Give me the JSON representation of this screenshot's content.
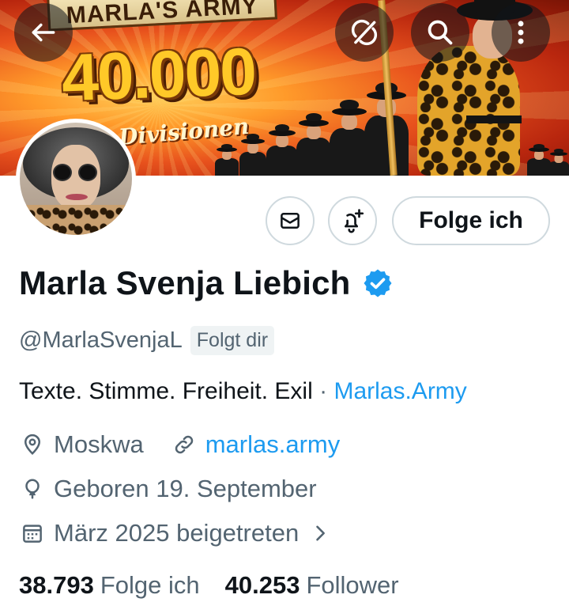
{
  "banner": {
    "ribbon_text": "MARLA'S ARMY",
    "headline": "40.000",
    "subline": "Divisionen"
  },
  "profile": {
    "display_name": "Marla Svenja Liebich",
    "verified": true,
    "handle": "@MarlaSvenjaL",
    "follows_you_badge": "Folgt dir",
    "bio_text": "Texte. Stimme. Freiheit. Exil",
    "bio_separator": "·",
    "bio_link": "Marlas.Army",
    "location": "Moskwa",
    "website": "marlas.army",
    "birthday": "Geboren 19. September",
    "joined": "März 2025 beigetreten"
  },
  "actions": {
    "follow_label": "Folge ich",
    "message_icon": "mail-icon",
    "notify_icon": "bell-plus-icon"
  },
  "toolbar": {
    "back_icon": "arrow-left-icon",
    "boost_icon": "repost-off-icon",
    "search_icon": "search-icon",
    "more_icon": "more-vertical-icon"
  },
  "stats": {
    "following_count": "38.793",
    "following_label": "Folge ich",
    "followers_count": "40.253",
    "followers_label": "Follower"
  },
  "colors": {
    "accent_link": "#1d9bf0",
    "verified_badge": "#1d9bf0",
    "secondary_text": "#536471",
    "primary_text": "#0f1419"
  }
}
